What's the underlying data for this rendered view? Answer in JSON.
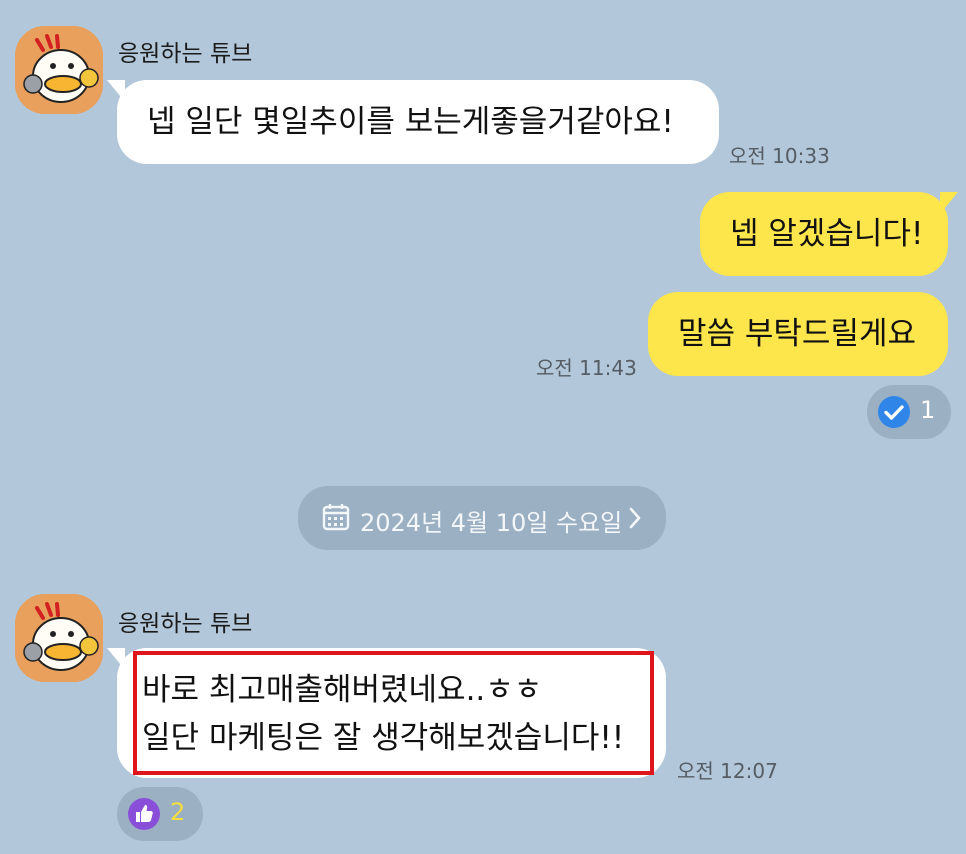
{
  "colors": {
    "background": "#b2c7da",
    "incoming_bubble": "#ffffff",
    "outgoing_bubble": "#fde54c",
    "highlight_box": "#e0141b",
    "read_check": "#2f86e8",
    "like_badge": "#8a4fd8"
  },
  "messages": [
    {
      "sender": "응원하는 튜브",
      "text": "넵 일단 몇일추이를 보는게좋을거같아요!",
      "time": "오전 10:33"
    },
    {
      "outgoing": [
        {
          "text": "넵 알겠습니다!"
        },
        {
          "text": "말씀 부탁드릴게요"
        }
      ],
      "time": "오전 11:43",
      "reaction": {
        "icon": "check-circle-icon",
        "count": "1"
      }
    }
  ],
  "date_divider": {
    "icon": "calendar-icon",
    "text": "2024년 4월 10일 수요일",
    "chevron": "chevron-right-icon"
  },
  "messages2": [
    {
      "sender": "응원하는 튜브",
      "lines": [
        "바로 최고매출해버렸네요..ㅎㅎ",
        "일단 마케팅은 잘 생각해보겠습니다!!"
      ],
      "time": "오전 12:07",
      "reaction": {
        "icon": "thumbs-up-icon",
        "count": "2"
      }
    }
  ]
}
